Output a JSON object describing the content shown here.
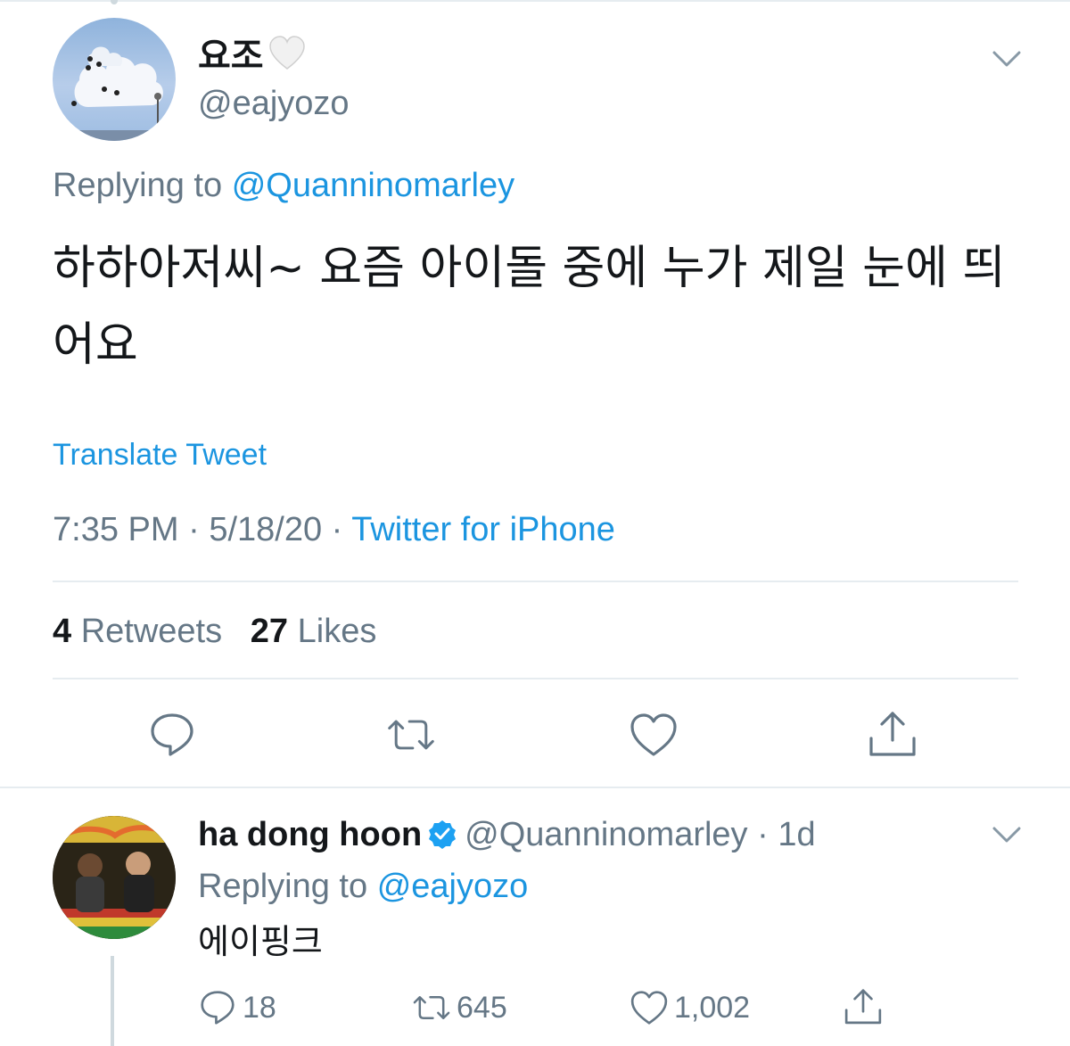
{
  "tweet": {
    "display_name": "요조",
    "display_emoji": "white-heart-emoji",
    "handle": "@eajyozo",
    "replying_prefix": "Replying to",
    "replying_handle": "@Quanninomarley",
    "text": "하하아저씨~ 요즘 아이돌 중에 누가 제일 눈에 띄어요",
    "translate_label": "Translate Tweet",
    "time": "7:35 PM",
    "separator": "·",
    "date": "5/18/20",
    "source": "Twitter for iPhone",
    "retweets_count": "4",
    "retweets_label": "Retweets",
    "likes_count": "27",
    "likes_label": "Likes"
  },
  "actions": {
    "reply_icon": "speech-bubble-icon",
    "retweet_icon": "retweet-icon",
    "like_icon": "heart-icon",
    "share_icon": "share-icon",
    "more_icon": "chevron-down-icon"
  },
  "reply": {
    "display_name": "ha dong hoon",
    "verified_icon": "verified-badge-icon",
    "handle": "@Quanninomarley",
    "separator": "·",
    "age": "1d",
    "replying_prefix": "Replying to",
    "replying_handle": "@eajyozo",
    "text": "에이핑크",
    "reply_count": "18",
    "retweet_count": "645",
    "like_count": "1,002"
  },
  "colors": {
    "text": "#14171a",
    "secondary": "#657786",
    "link": "#1b95e0",
    "divider": "#e6ecf0",
    "verified": "#1da1f2"
  }
}
